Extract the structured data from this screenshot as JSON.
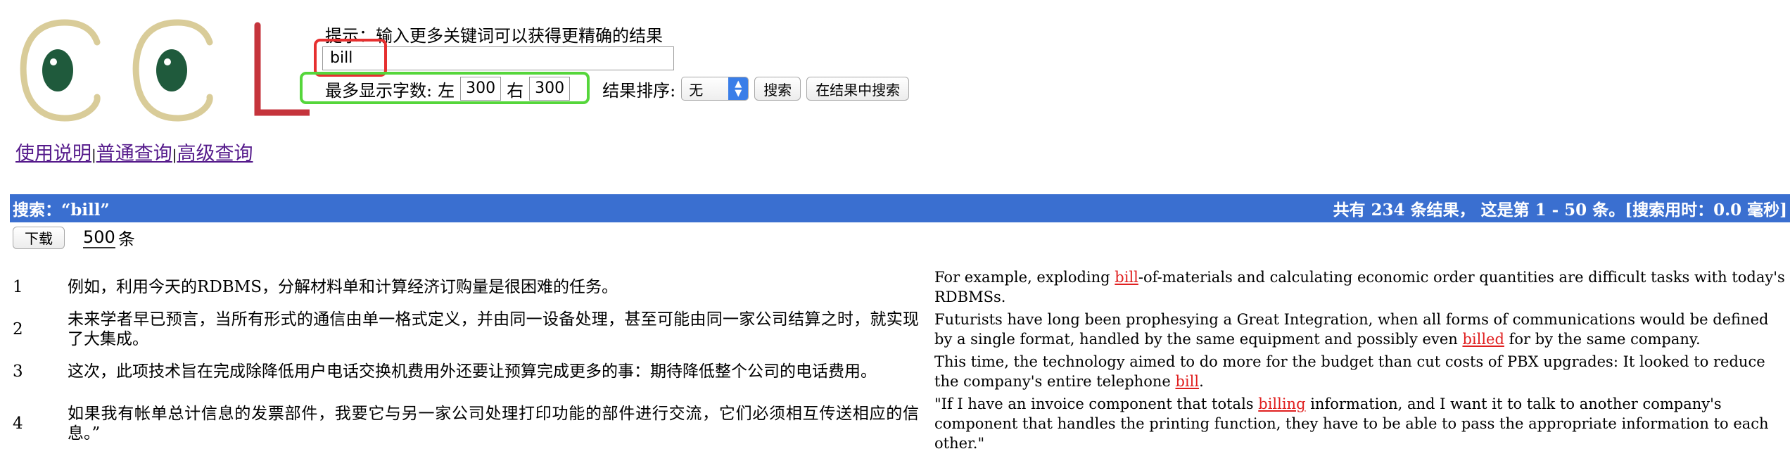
{
  "search": {
    "hint": "提示：输入更多关键词可以获得更精确的结果",
    "query": "bill",
    "max_chars_label": "最多显示字数:",
    "left_label": "左",
    "left_value": "300",
    "right_label": "右",
    "right_value": "300",
    "sort_label": "结果排序:",
    "sort_value": "无",
    "search_button": "搜索",
    "search_in_results_button": "在结果中搜索"
  },
  "nav": {
    "links": [
      "使用说明",
      "普通查询",
      "高级查询"
    ],
    "separator": "|"
  },
  "result_bar": {
    "search_prefix": "搜索：",
    "search_term": "“bill”",
    "summary_prefix": "共有",
    "total": "234",
    "summary_mid": "条结果， 这是第",
    "range": "1 - 50",
    "summary_end": "条。[搜索用时：",
    "time": "0.0 毫秒",
    "close": "]"
  },
  "download": {
    "button": "下载",
    "count": "500",
    "unit": "条"
  },
  "results": [
    {
      "num": "1",
      "zh": "例如，利用今天的RDBMS，分解材料单和计算经济订购量是很困难的任务。",
      "en_before": "For example, exploding ",
      "en_match": "bill",
      "en_after": "-of-materials and calculating economic order quantities are difficult tasks with today's RDBMSs."
    },
    {
      "num": "2",
      "zh": "未来学者早已预言，当所有形式的通信由单一格式定义，并由同一设备处理，甚至可能由同一家公司结算之时，就实现了大集成。",
      "en_before": "Futurists have long been prophesying a Great Integration, when all forms of communications would be defined by a single format, handled by the same equipment and possibly even ",
      "en_match": "billed",
      "en_after": " for by the same company."
    },
    {
      "num": "3",
      "zh": "这次，此项技术旨在完成除降低用户电话交换机费用外还要让预算完成更多的事：期待降低整个公司的电话费用。",
      "en_before": "This time, the technology aimed to do more for the budget than cut costs of PBX upgrades: It looked to reduce the company's entire telephone ",
      "en_match": "bill",
      "en_after": "."
    },
    {
      "num": "4",
      "zh": "如果我有帐单总计信息的发票部件，我要它与另一家公司处理打印功能的部件进行交流，它们必须相互传送相应的信息。”",
      "en_before": "\"If I have an invoice component that totals ",
      "en_match": "billing",
      "en_after": " information, and I want it to talk to another company's component that handles the printing function, they have to be able to pass the appropriate information to each other.\""
    }
  ]
}
